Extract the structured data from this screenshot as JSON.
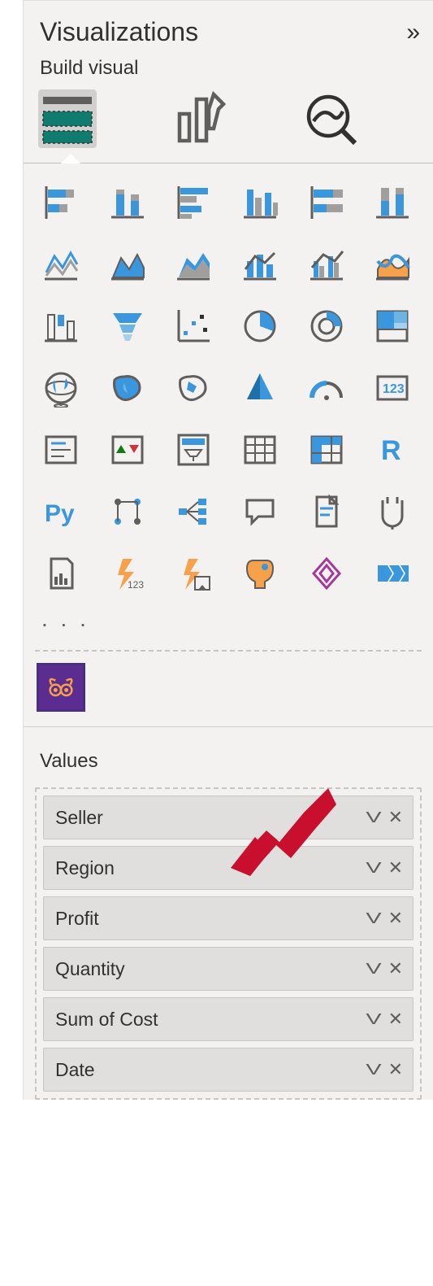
{
  "header": {
    "title": "Visualizations",
    "collapse_glyph": "»"
  },
  "subheader": "Build visual",
  "tabs": {
    "build": "build-visual",
    "format": "format-visual",
    "analytics": "analytics"
  },
  "visual_types": [
    "stacked-bar-chart",
    "stacked-column-chart",
    "clustered-bar-chart",
    "clustered-column-chart",
    "100-stacked-bar-chart",
    "100-stacked-column-chart",
    "line-chart",
    "area-chart",
    "stacked-area-chart",
    "line-stacked-column-chart",
    "line-clustered-column-chart",
    "ribbon-chart",
    "waterfall-chart",
    "funnel-chart",
    "scatter-chart",
    "pie-chart",
    "donut-chart",
    "treemap",
    "map",
    "filled-map",
    "shape-map",
    "azure-map",
    "gauge",
    "card",
    "multi-row-card",
    "kpi",
    "slicer",
    "table",
    "matrix",
    "r-script-visual",
    "python-visual",
    "key-influencers",
    "decomposition-tree",
    "qa",
    "smart-narrative",
    "goals",
    "paginated-report",
    "power-automate",
    "power-apps",
    "ai-visual",
    "arcgis",
    "metrics"
  ],
  "more_label": ". . .",
  "custom_visual": "charticulator",
  "values": {
    "label": "Values",
    "fields": [
      "Seller",
      "Region",
      "Profit",
      "Quantity",
      "Sum of Cost",
      "Date"
    ]
  },
  "annotation": {
    "arrow_color": "#c8102e"
  }
}
